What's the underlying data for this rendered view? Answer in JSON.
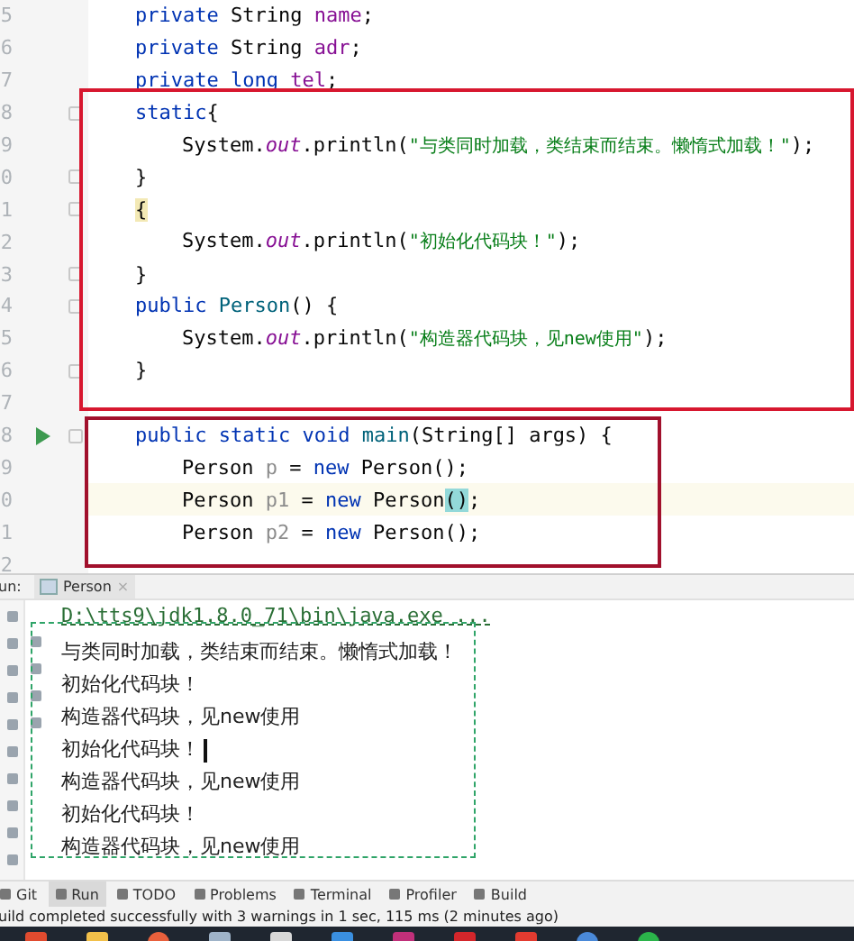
{
  "editor": {
    "lines": [
      {
        "number": "5",
        "kind": "member",
        "run": false,
        "fold": false,
        "current": false,
        "tokens": [
          {
            "text": "private ",
            "kind": "keyword"
          },
          {
            "text": "String ",
            "kind": "plain"
          },
          {
            "text": "name",
            "kind": "field"
          },
          {
            "text": ";",
            "kind": "plain"
          }
        ]
      },
      {
        "number": "6",
        "kind": "member",
        "run": false,
        "fold": false,
        "current": false,
        "tokens": [
          {
            "text": "private ",
            "kind": "keyword"
          },
          {
            "text": "String ",
            "kind": "plain"
          },
          {
            "text": "adr",
            "kind": "field"
          },
          {
            "text": ";",
            "kind": "plain"
          }
        ]
      },
      {
        "number": "7",
        "kind": "member",
        "run": false,
        "fold": false,
        "current": false,
        "tokens": [
          {
            "text": "private long ",
            "kind": "keyword"
          },
          {
            "text": "tel",
            "kind": "field"
          },
          {
            "text": ";",
            "kind": "plain"
          }
        ]
      },
      {
        "number": "8",
        "kind": "member",
        "run": false,
        "fold": true,
        "current": false,
        "tokens": [
          {
            "text": "static",
            "kind": "keyword"
          },
          {
            "text": "{",
            "kind": "plain"
          }
        ]
      },
      {
        "number": "9",
        "kind": "statement",
        "run": false,
        "fold": false,
        "current": false,
        "tokens": [
          {
            "text": "System.",
            "kind": "plain"
          },
          {
            "text": "out",
            "kind": "static"
          },
          {
            "text": ".println(",
            "kind": "plain"
          },
          {
            "text": "\"与类同时加载，类结束而结束。懒惰式加载！\"",
            "kind": "string"
          },
          {
            "text": ");",
            "kind": "plain"
          }
        ]
      },
      {
        "number": "0",
        "kind": "member",
        "run": false,
        "fold": true,
        "current": false,
        "tokens": [
          {
            "text": "}",
            "kind": "plain"
          }
        ]
      },
      {
        "number": "1",
        "kind": "member",
        "run": false,
        "fold": true,
        "current": false,
        "tokens": [
          {
            "text": "{",
            "kind": "match"
          }
        ]
      },
      {
        "number": "2",
        "kind": "statement",
        "run": false,
        "fold": false,
        "current": false,
        "tokens": [
          {
            "text": "System.",
            "kind": "plain"
          },
          {
            "text": "out",
            "kind": "static"
          },
          {
            "text": ".println(",
            "kind": "plain"
          },
          {
            "text": "\"初始化代码块！\"",
            "kind": "string"
          },
          {
            "text": ");",
            "kind": "plain"
          }
        ]
      },
      {
        "number": "3",
        "kind": "member",
        "run": false,
        "fold": true,
        "current": false,
        "tokens": [
          {
            "text": "}",
            "kind": "plain"
          }
        ]
      },
      {
        "number": "4",
        "kind": "member",
        "run": false,
        "fold": true,
        "current": false,
        "tokens": [
          {
            "text": "public ",
            "kind": "keyword"
          },
          {
            "text": "Person",
            "kind": "method"
          },
          {
            "text": "() {",
            "kind": "plain"
          }
        ]
      },
      {
        "number": "5",
        "kind": "statement",
        "run": false,
        "fold": false,
        "current": false,
        "tokens": [
          {
            "text": "System.",
            "kind": "plain"
          },
          {
            "text": "out",
            "kind": "static"
          },
          {
            "text": ".println(",
            "kind": "plain"
          },
          {
            "text": "\"构造器代码块，见new使用\"",
            "kind": "string"
          },
          {
            "text": ");",
            "kind": "plain"
          }
        ]
      },
      {
        "number": "6",
        "kind": "member",
        "run": false,
        "fold": true,
        "current": false,
        "tokens": [
          {
            "text": "}",
            "kind": "plain"
          }
        ]
      },
      {
        "number": "7",
        "run": false,
        "fold": false,
        "current": false
      },
      {
        "number": "8",
        "kind": "member",
        "run": true,
        "fold": true,
        "current": false,
        "tokens": [
          {
            "text": "public static void ",
            "kind": "keyword"
          },
          {
            "text": "main",
            "kind": "method"
          },
          {
            "text": "(String[] args) {",
            "kind": "plain"
          }
        ]
      },
      {
        "number": "9",
        "kind": "statement",
        "run": false,
        "fold": false,
        "current": false,
        "tokens": [
          {
            "text": "Person ",
            "kind": "plain"
          },
          {
            "text": "p",
            "kind": "unused"
          },
          {
            "text": " = ",
            "kind": "plain"
          },
          {
            "text": "new ",
            "kind": "keyword"
          },
          {
            "text": "Person();",
            "kind": "plain"
          }
        ]
      },
      {
        "number": "0",
        "kind": "statement",
        "run": false,
        "fold": false,
        "current": true,
        "tokens": [
          {
            "text": "Person ",
            "kind": "plain"
          },
          {
            "text": "p1",
            "kind": "unused"
          },
          {
            "text": " = ",
            "kind": "plain"
          },
          {
            "text": "new ",
            "kind": "keyword"
          },
          {
            "text": "Person",
            "kind": "plain"
          },
          {
            "text": "()",
            "kind": "match-paren"
          },
          {
            "text": ";",
            "kind": "plain"
          }
        ]
      },
      {
        "number": "1",
        "kind": "statement",
        "run": false,
        "fold": false,
        "current": false,
        "tokens": [
          {
            "text": "Person ",
            "kind": "plain"
          },
          {
            "text": "p2",
            "kind": "unused"
          },
          {
            "text": " = ",
            "kind": "plain"
          },
          {
            "text": "new ",
            "kind": "keyword"
          },
          {
            "text": "Person();",
            "kind": "plain"
          }
        ]
      },
      {
        "number": "2",
        "run": false,
        "fold": false,
        "current": false
      }
    ]
  },
  "run_panel": {
    "label": "un:",
    "tab": {
      "title": "Person",
      "close": "×"
    },
    "command": "D:\\tts9\\jdk1.8.0_71\\bin\\java.exe ...",
    "output": [
      {
        "text": "与类同时加载，类结束而结束。懒惰式加载！",
        "cursor": false
      },
      {
        "text": "初始化代码块！",
        "cursor": false
      },
      {
        "text": "构造器代码块，见new使用",
        "cursor": false
      },
      {
        "text": "初始化代码块！",
        "cursor": true
      },
      {
        "text": "构造器代码块，见new使用",
        "cursor": false
      },
      {
        "text": "初始化代码块！",
        "cursor": false
      },
      {
        "text": "构造器代码块，见new使用",
        "cursor": false
      }
    ]
  },
  "tool_windows": [
    {
      "label": "Git",
      "selected": false
    },
    {
      "label": "Run",
      "selected": true
    },
    {
      "label": "TODO",
      "selected": false
    },
    {
      "label": "Problems",
      "selected": false
    },
    {
      "label": "Terminal",
      "selected": false
    },
    {
      "label": "Profiler",
      "selected": false
    },
    {
      "label": "Build",
      "selected": false
    }
  ],
  "status_bar": "uild completed successfully with 3 warnings in 1 sec, 115 ms (2 minutes ago)"
}
